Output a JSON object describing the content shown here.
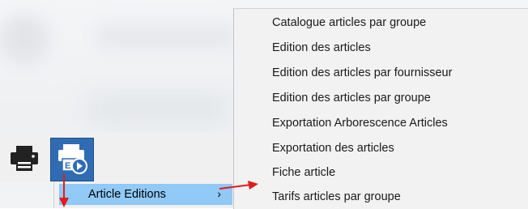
{
  "submenu": {
    "item_label": "Article Editions",
    "chevron": "›",
    "chevron_icon": "chevron-right-icon"
  },
  "toolbar": {
    "print_icon": "printer-icon",
    "article_icon": "article-editions-icon",
    "accent_color": "#2f6cb3"
  },
  "menu": {
    "items": [
      {
        "label": "Catalogue articles par groupe"
      },
      {
        "label": "Edition des articles"
      },
      {
        "label": "Edition des articles par fournisseur"
      },
      {
        "label": "Edition des articles par groupe"
      },
      {
        "label": "Exportation Arborescence Articles"
      },
      {
        "label": "Exportation des articles"
      },
      {
        "label": "Fiche article"
      },
      {
        "label": "Tarifs articles par groupe"
      }
    ]
  },
  "annotation_color": "#e31b1b"
}
